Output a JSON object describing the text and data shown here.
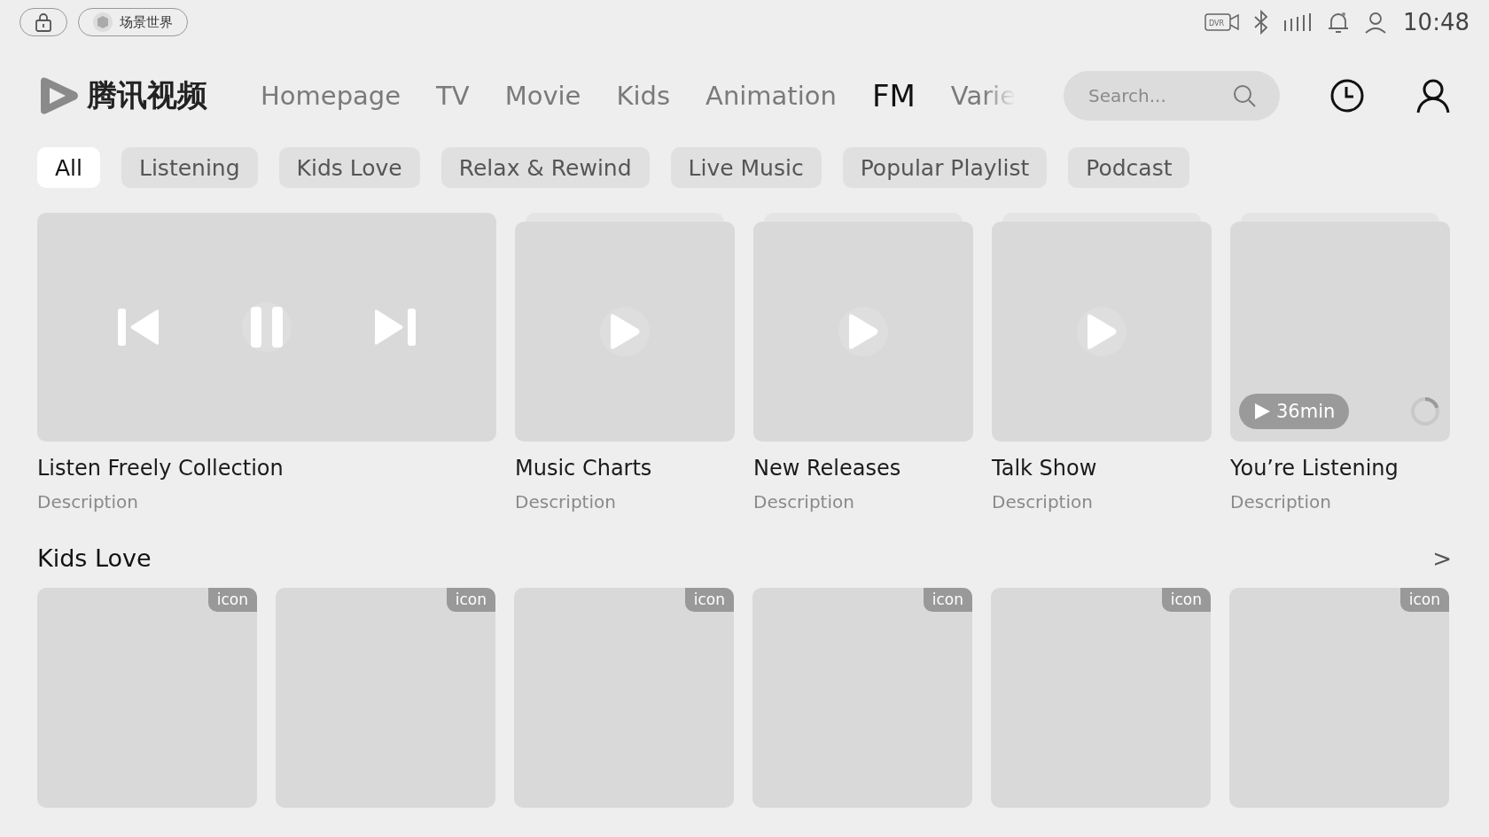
{
  "status_bar": {
    "scene_label": "场景世界",
    "time": "10:48",
    "dvr_label": "DVR"
  },
  "header": {
    "logo_text": "腾讯视频",
    "nav": [
      {
        "label": "Homepage",
        "selected": false
      },
      {
        "label": "TV",
        "selected": false
      },
      {
        "label": "Movie",
        "selected": false
      },
      {
        "label": "Kids",
        "selected": false
      },
      {
        "label": "Animation",
        "selected": false
      },
      {
        "label": "FM",
        "selected": true
      },
      {
        "label": "Varie",
        "selected": false
      }
    ],
    "search": {
      "placeholder": "Search..."
    }
  },
  "chips": [
    {
      "label": "All",
      "selected": true
    },
    {
      "label": "Listening",
      "selected": false
    },
    {
      "label": "Kids Love",
      "selected": false
    },
    {
      "label": "Relax & Rewind",
      "selected": false
    },
    {
      "label": "Live Music",
      "selected": false
    },
    {
      "label": "Popular Playlist",
      "selected": false
    },
    {
      "label": "Podcast",
      "selected": false
    }
  ],
  "featured": [
    {
      "kind": "player",
      "title": "Listen Freely Collection",
      "description": "Description"
    },
    {
      "kind": "play",
      "title": "Music Charts",
      "description": "Description"
    },
    {
      "kind": "play",
      "title": "New Releases",
      "description": "Description"
    },
    {
      "kind": "play",
      "title": "Talk Show",
      "description": "Description"
    },
    {
      "kind": "resume",
      "title": "You’re Listening",
      "description": "Description",
      "duration": "36min",
      "level": 0.2
    }
  ],
  "kids_love": {
    "title": "Kids Love",
    "more": ">",
    "items": [
      {
        "badge": "icon"
      },
      {
        "badge": "icon"
      },
      {
        "badge": "icon"
      },
      {
        "badge": "icon"
      },
      {
        "badge": "icon"
      },
      {
        "badge": "icon"
      }
    ]
  }
}
